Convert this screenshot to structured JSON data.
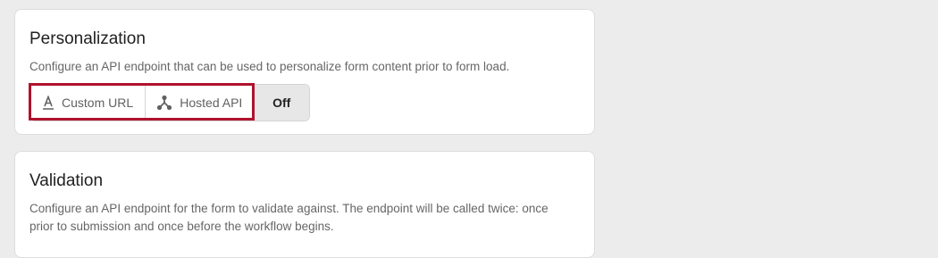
{
  "personalization": {
    "title": "Personalization",
    "description": "Configure an API endpoint that can be used to personalize form content prior to form load.",
    "options": {
      "custom_url": {
        "label": "Custom URL",
        "icon": "text-format-icon"
      },
      "hosted_api": {
        "label": "Hosted API",
        "icon": "api-icon"
      },
      "off": {
        "label": "Off",
        "selected": true
      }
    }
  },
  "validation": {
    "title": "Validation",
    "description": "Configure an API endpoint for the form to validate against. The endpoint will be called twice: once prior to submission and once before the workflow begins."
  },
  "colors": {
    "background": "#ececec",
    "card": "#ffffff",
    "highlight": "#b0122d",
    "selected_segment": "#e7e7e7"
  }
}
